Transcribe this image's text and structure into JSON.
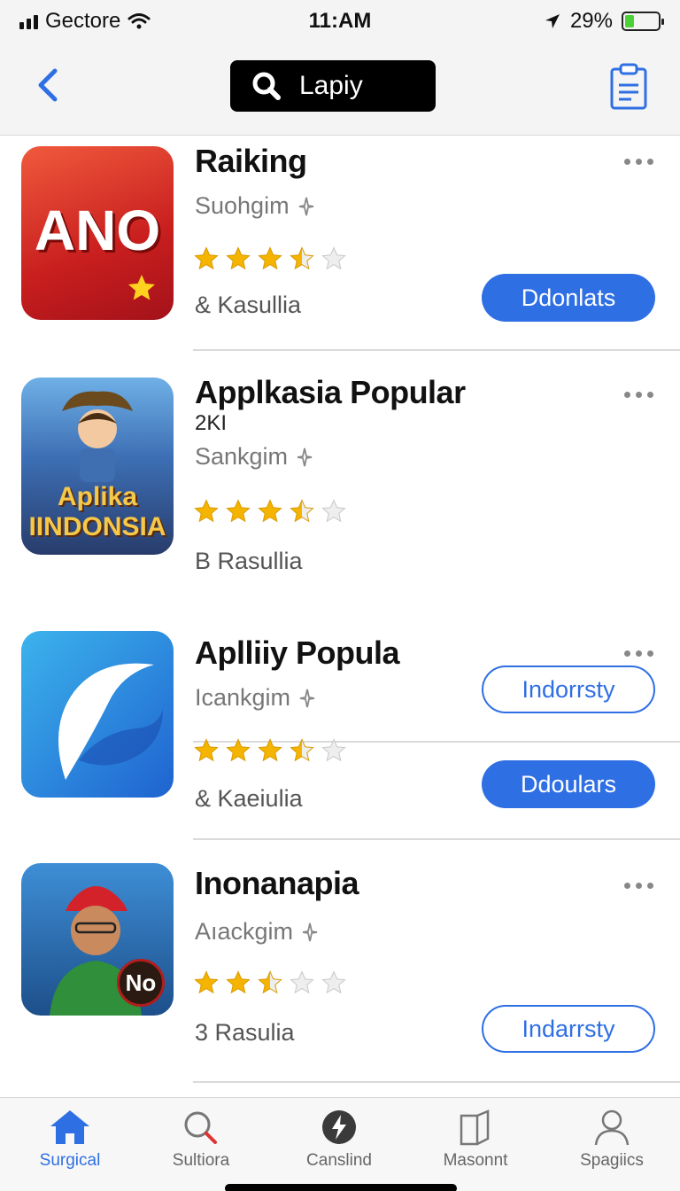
{
  "status_bar": {
    "carrier": "Gectore",
    "time": "11:AM",
    "battery": "29%",
    "battery_level": 0.29
  },
  "header": {
    "search_value": "Lapiy"
  },
  "apps": [
    {
      "name": "Raiking",
      "extra": "",
      "subtitle": "Suohgim",
      "rating": 3.5,
      "count": "& Kasullia",
      "button": "Ddonlats",
      "button_style": "filled",
      "icon_text": "ANO",
      "icon_colors": [
        "#e8362b",
        "#b8141a"
      ]
    },
    {
      "name": "Applkasia Popular",
      "extra": "2KI",
      "subtitle": "Sankgim",
      "rating": 3.5,
      "count": "B Rasullia",
      "button": "Indorrsty",
      "button_style": "outline",
      "icon_text": "Aplika IINDONSIA",
      "icon_colors": [
        "#3b6fb6",
        "#2a3d66"
      ]
    },
    {
      "name": "Aplliiy Popula",
      "extra": "",
      "subtitle": "Icankgim",
      "rating": 3.5,
      "count": "& Kaeiulia",
      "button": "Ddoulars",
      "button_style": "filled",
      "icon_text": "",
      "icon_colors": [
        "#2a9ae0",
        "#1d5fc4"
      ]
    },
    {
      "name": "Inonanapia",
      "extra": "",
      "subtitle": "Aıackgim",
      "rating": 2.5,
      "count": "3 Rasulia",
      "button": "Indarrsty",
      "button_style": "outline",
      "icon_text": "No",
      "icon_colors": [
        "#2e7bbf",
        "#1b4f86"
      ]
    }
  ],
  "tabs": [
    {
      "label": "Surgical",
      "icon": "home-icon",
      "active": true
    },
    {
      "label": "Sultiora",
      "icon": "search-icon",
      "active": false
    },
    {
      "label": "Canslind",
      "icon": "bolt-icon",
      "active": false
    },
    {
      "label": "Masonnt",
      "icon": "book-icon",
      "active": false
    },
    {
      "label": "Spagiics",
      "icon": "person-icon",
      "active": false
    }
  ],
  "colors": {
    "accent": "#2f6fe4",
    "star": "#f5b400"
  }
}
